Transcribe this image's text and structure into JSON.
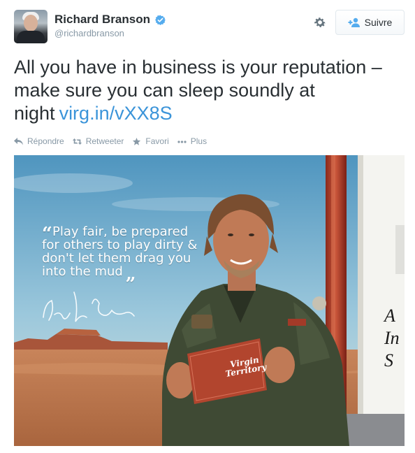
{
  "header": {
    "name": "Richard Branson",
    "screen_name": "@richardbranson",
    "follow_label": "Suivre"
  },
  "tweet": {
    "text": "All you have in business is your reputation – make sure you can sleep soundly at night",
    "link": "virg.in/vXX8S"
  },
  "actions": [
    {
      "icon": "reply-icon",
      "label": "Répondre"
    },
    {
      "icon": "retweet-icon",
      "label": "Retweeter"
    },
    {
      "icon": "star-icon",
      "label": "Favori"
    },
    {
      "icon": "more-icon",
      "label": "Plus"
    }
  ],
  "media": {
    "quote": "Play fair, be prepared for others to play dirty & don't let them drag you into the mud",
    "side_text_1": "A",
    "side_text_2": "In",
    "side_text_3": "S",
    "card_text": "Virgin Territory"
  },
  "colors": {
    "link": "#3b94d9",
    "verified": "#55acee",
    "muted": "#8899a6"
  }
}
